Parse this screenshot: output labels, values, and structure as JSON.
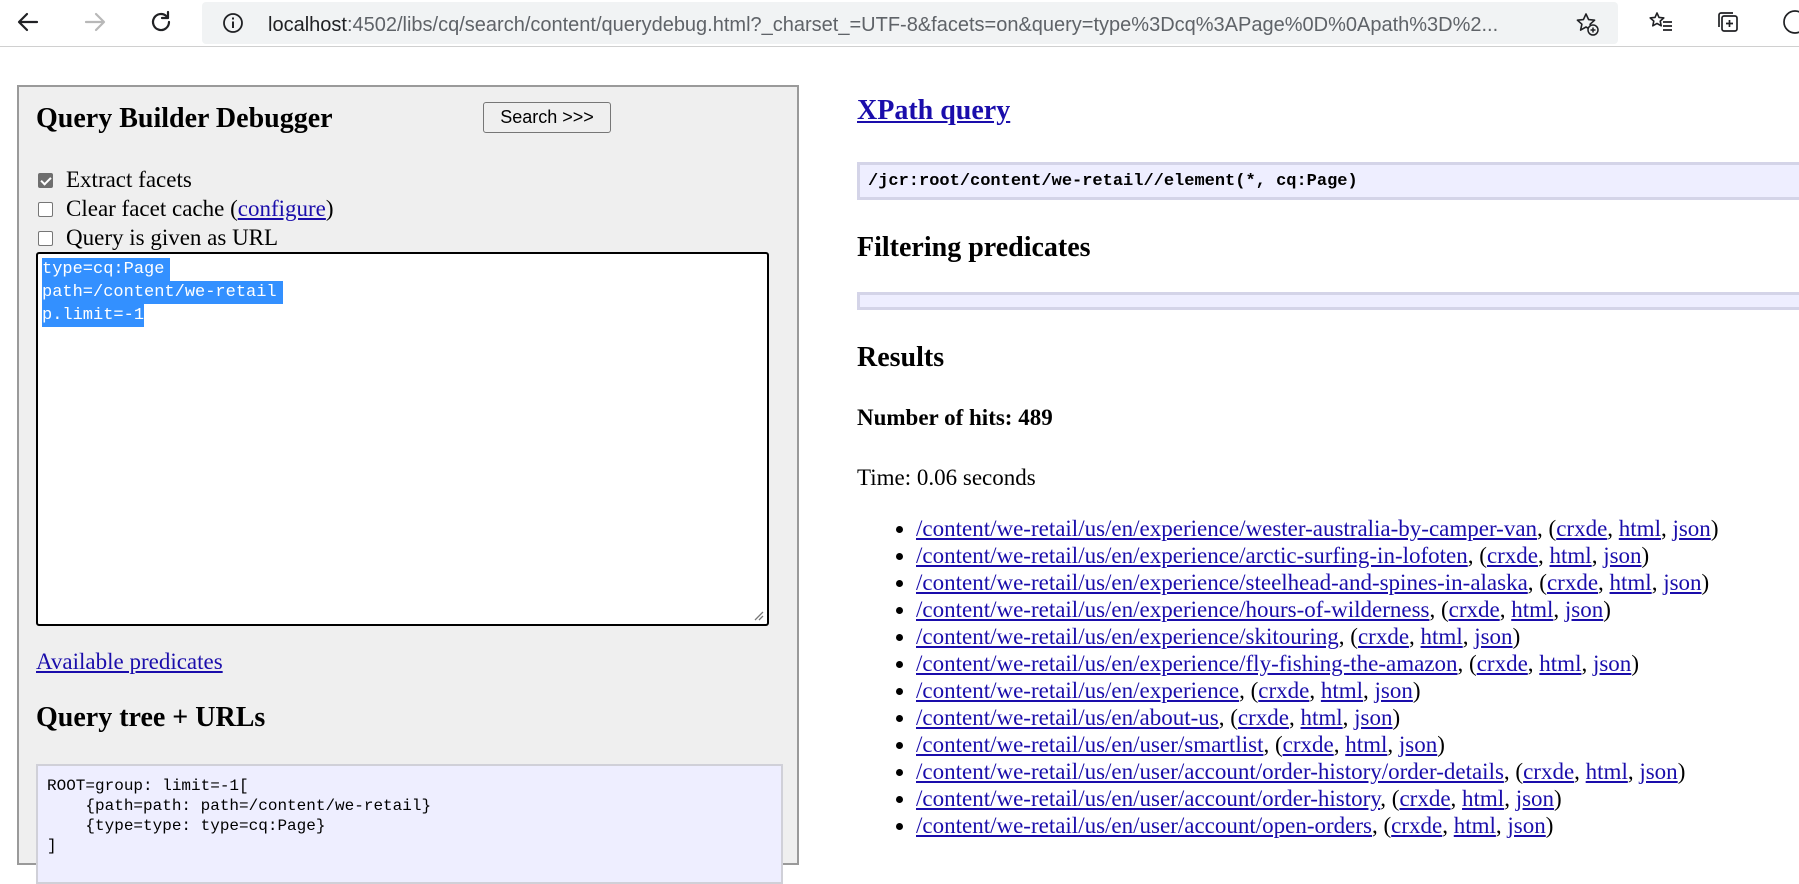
{
  "browser": {
    "url_host": "localhost",
    "url_rest": ":4502/libs/cq/search/content/querydebug.html?_charset_=UTF-8&facets=on&query=type%3Dcq%3APage%0D%0Apath%3D%2..."
  },
  "left": {
    "title": "Query Builder Debugger",
    "search_button": "Search >>>",
    "checkboxes": [
      {
        "label": "Extract facets",
        "checked": true
      },
      {
        "label_before": "Clear facet cache (",
        "link": "configure",
        "label_after": ")",
        "checked": false
      },
      {
        "label": "Query is given as URL",
        "checked": false
      }
    ],
    "query_lines": [
      "type=cq:Page",
      "path=/content/we-retail",
      "p.limit=-1"
    ],
    "available_predicates": "Available predicates",
    "query_tree_title": "Query tree + URLs",
    "query_tree_lines": [
      "ROOT=group: limit=-1[",
      "    {path=path: path=/content/we-retail}",
      "    {type=type: type=cq:Page}",
      "]"
    ]
  },
  "right": {
    "xpath_title": "XPath query",
    "xpath": "/jcr:root/content/we-retail//element(*, cq:Page)",
    "filtering_title": "Filtering predicates",
    "results_title": "Results",
    "hits": "Number of hits: 489",
    "time": "Time: 0.06 seconds",
    "link_labels": {
      "crxde": "crxde",
      "html": "html",
      "json": "json"
    },
    "results": [
      "/content/we-retail/us/en/experience/wester-australia-by-camper-van",
      "/content/we-retail/us/en/experience/arctic-surfing-in-lofoten",
      "/content/we-retail/us/en/experience/steelhead-and-spines-in-alaska",
      "/content/we-retail/us/en/experience/hours-of-wilderness",
      "/content/we-retail/us/en/experience/skitouring",
      "/content/we-retail/us/en/experience/fly-fishing-the-amazon",
      "/content/we-retail/us/en/experience",
      "/content/we-retail/us/en/about-us",
      "/content/we-retail/us/en/user/smartlist",
      "/content/we-retail/us/en/user/account/order-history/order-details",
      "/content/we-retail/us/en/user/account/order-history",
      "/content/we-retail/us/en/user/account/open-orders"
    ]
  }
}
